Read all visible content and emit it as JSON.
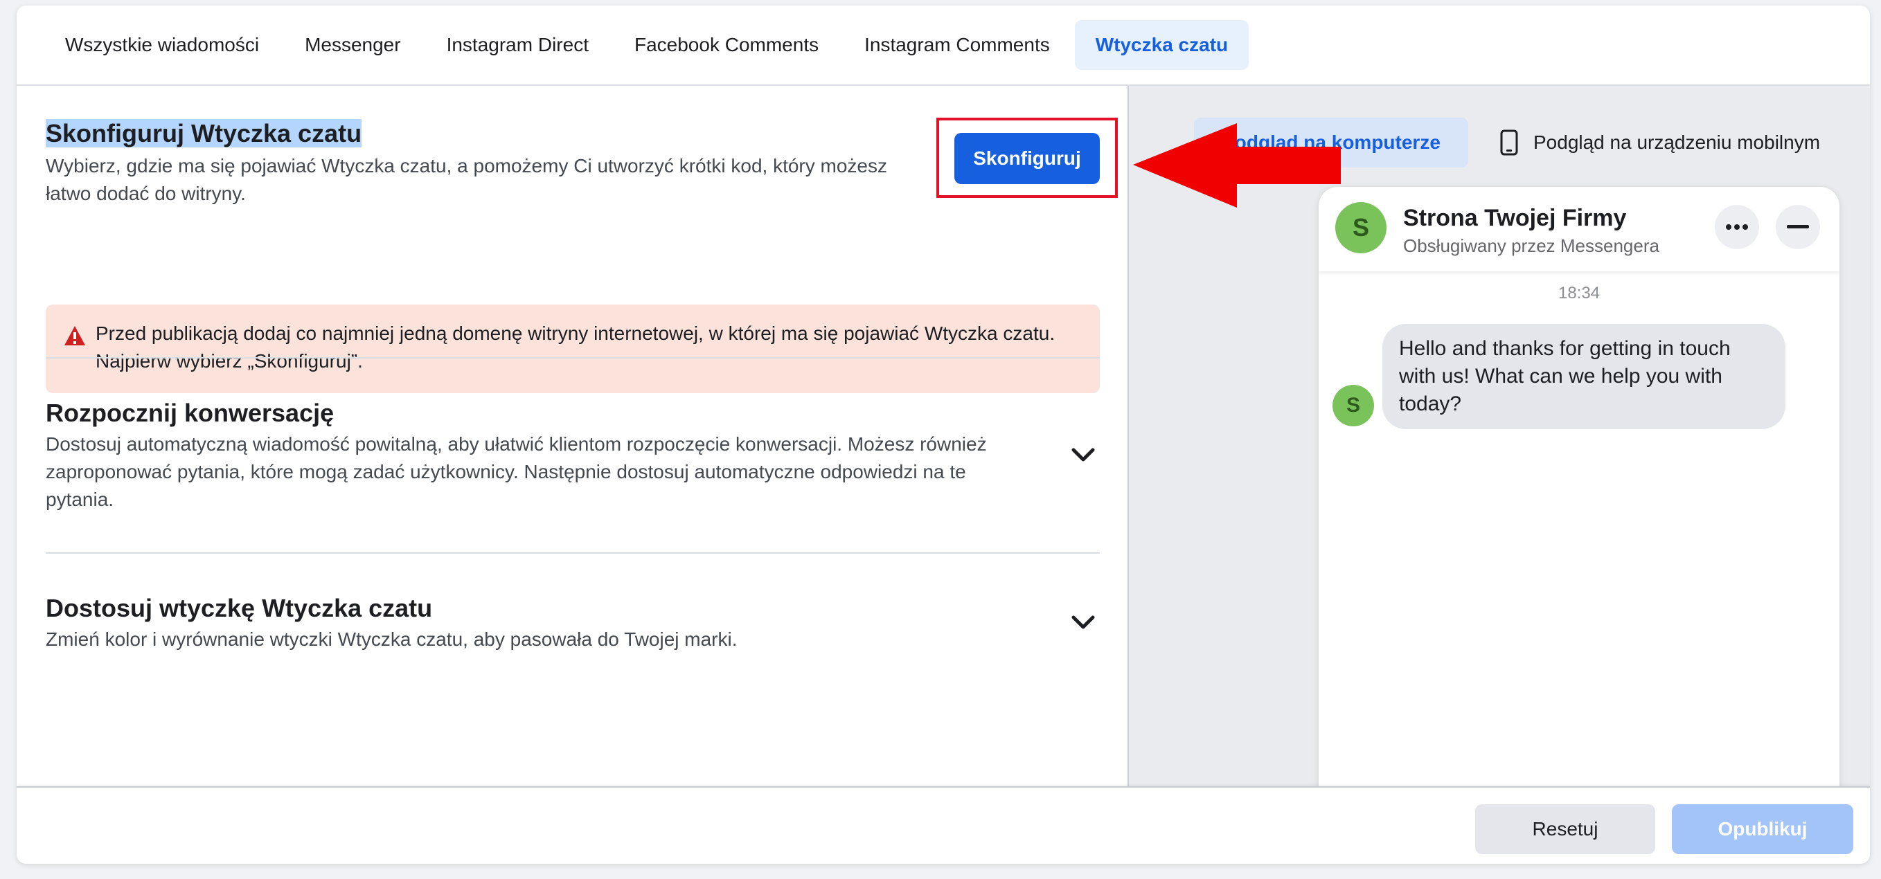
{
  "tabs": [
    {
      "label": "Wszystkie wiadomości"
    },
    {
      "label": "Messenger"
    },
    {
      "label": "Instagram Direct"
    },
    {
      "label": "Facebook Comments"
    },
    {
      "label": "Instagram Comments"
    },
    {
      "label": "Wtyczka czatu",
      "active": true
    }
  ],
  "setup": {
    "title": "Skonfiguruj Wtyczka czatu",
    "desc_line1": "Wybierz, gdzie ma się pojawiać Wtyczka czatu, a pomożemy Ci utworzyć krótki kod, który możesz",
    "desc_line2": "łatwo dodać do witryny.",
    "button": "Skonfiguruj"
  },
  "alert": {
    "line1": "Przed publikacją dodaj co najmniej jedną domenę witryny internetowej, w której ma się pojawiać Wtyczka czatu.",
    "line2": "Najpierw wybierz „Skonfiguruj”.",
    "icon": "warning-icon",
    "color": "#fbe3dc"
  },
  "start": {
    "title": "Rozpocznij konwersację",
    "desc_line1": "Dostosuj automatyczną wiadomość powitalną, aby ułatwić klientom rozpoczęcie konwersacji. Możesz również",
    "desc_line2": "zaproponować pytania, które mogą zadać użytkownicy. Następnie dostosuj automatyczne odpowiedzi na te",
    "desc_line3": "pytania."
  },
  "customize": {
    "title": "Dostosuj wtyczkę Wtyczka czatu",
    "desc": "Zmień kolor i wyrównanie wtyczki Wtyczka czatu, aby pasowała do Twojej marki."
  },
  "preview": {
    "desktop_tab": "Podgląd na komputerze",
    "mobile_tab": "Podgląd na urządzeniu mobilnym"
  },
  "chat": {
    "avatar_letter": "S",
    "name": "Strona Twojej Firmy",
    "subtitle": "Obsługiwany przez Messengera",
    "time": "18:34",
    "message": "Hello and thanks for getting in touch with us! What can we help you with today?"
  },
  "footer": {
    "reset": "Resetuj",
    "publish": "Opublikuj"
  },
  "colors": {
    "accent": "#1660e0",
    "annotation_red": "#e4102a"
  }
}
